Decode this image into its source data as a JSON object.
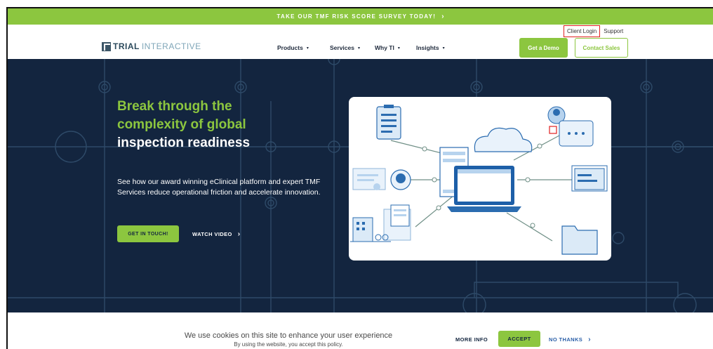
{
  "announcement": {
    "text": "TAKE OUR TMF RISK SCORE SURVEY TODAY!",
    "chevron": "›"
  },
  "header": {
    "logo": {
      "bold": "TRIAL",
      "light": "INTERACTIVE"
    },
    "nav": [
      {
        "label": "Products",
        "caret": "▾"
      },
      {
        "label": "Services",
        "caret": "▾"
      },
      {
        "label": "Why TI",
        "caret": "▾"
      },
      {
        "label": "Insights",
        "caret": "▾"
      }
    ],
    "utility": {
      "client_login": "Client Login",
      "support": "Support"
    },
    "get_demo": "Get a Demo",
    "contact_sales": "Contact Sales"
  },
  "hero": {
    "headline_green_1": "Break through the",
    "headline_green_2": "complexity of global",
    "headline_white": "inspection readiness",
    "body": "See how our award winning eClinical platform and expert TMF Services reduce operational friction and accelerate innovation.",
    "cta_primary": "GET IN TOUCH!",
    "cta_video": "WATCH VIDEO",
    "cta_video_chevron": "›"
  },
  "cookie": {
    "message": "We use cookies on this site to enhance your user experience",
    "sub": "By using the website, you accept this policy.",
    "more_info": "MORE INFO",
    "accept": "ACCEPT",
    "no_thanks": "NO THANKS",
    "no_thanks_chevron": "›"
  },
  "colors": {
    "accent": "#8cc63f",
    "hero_bg": "#13253f",
    "highlight": "#e02020"
  }
}
